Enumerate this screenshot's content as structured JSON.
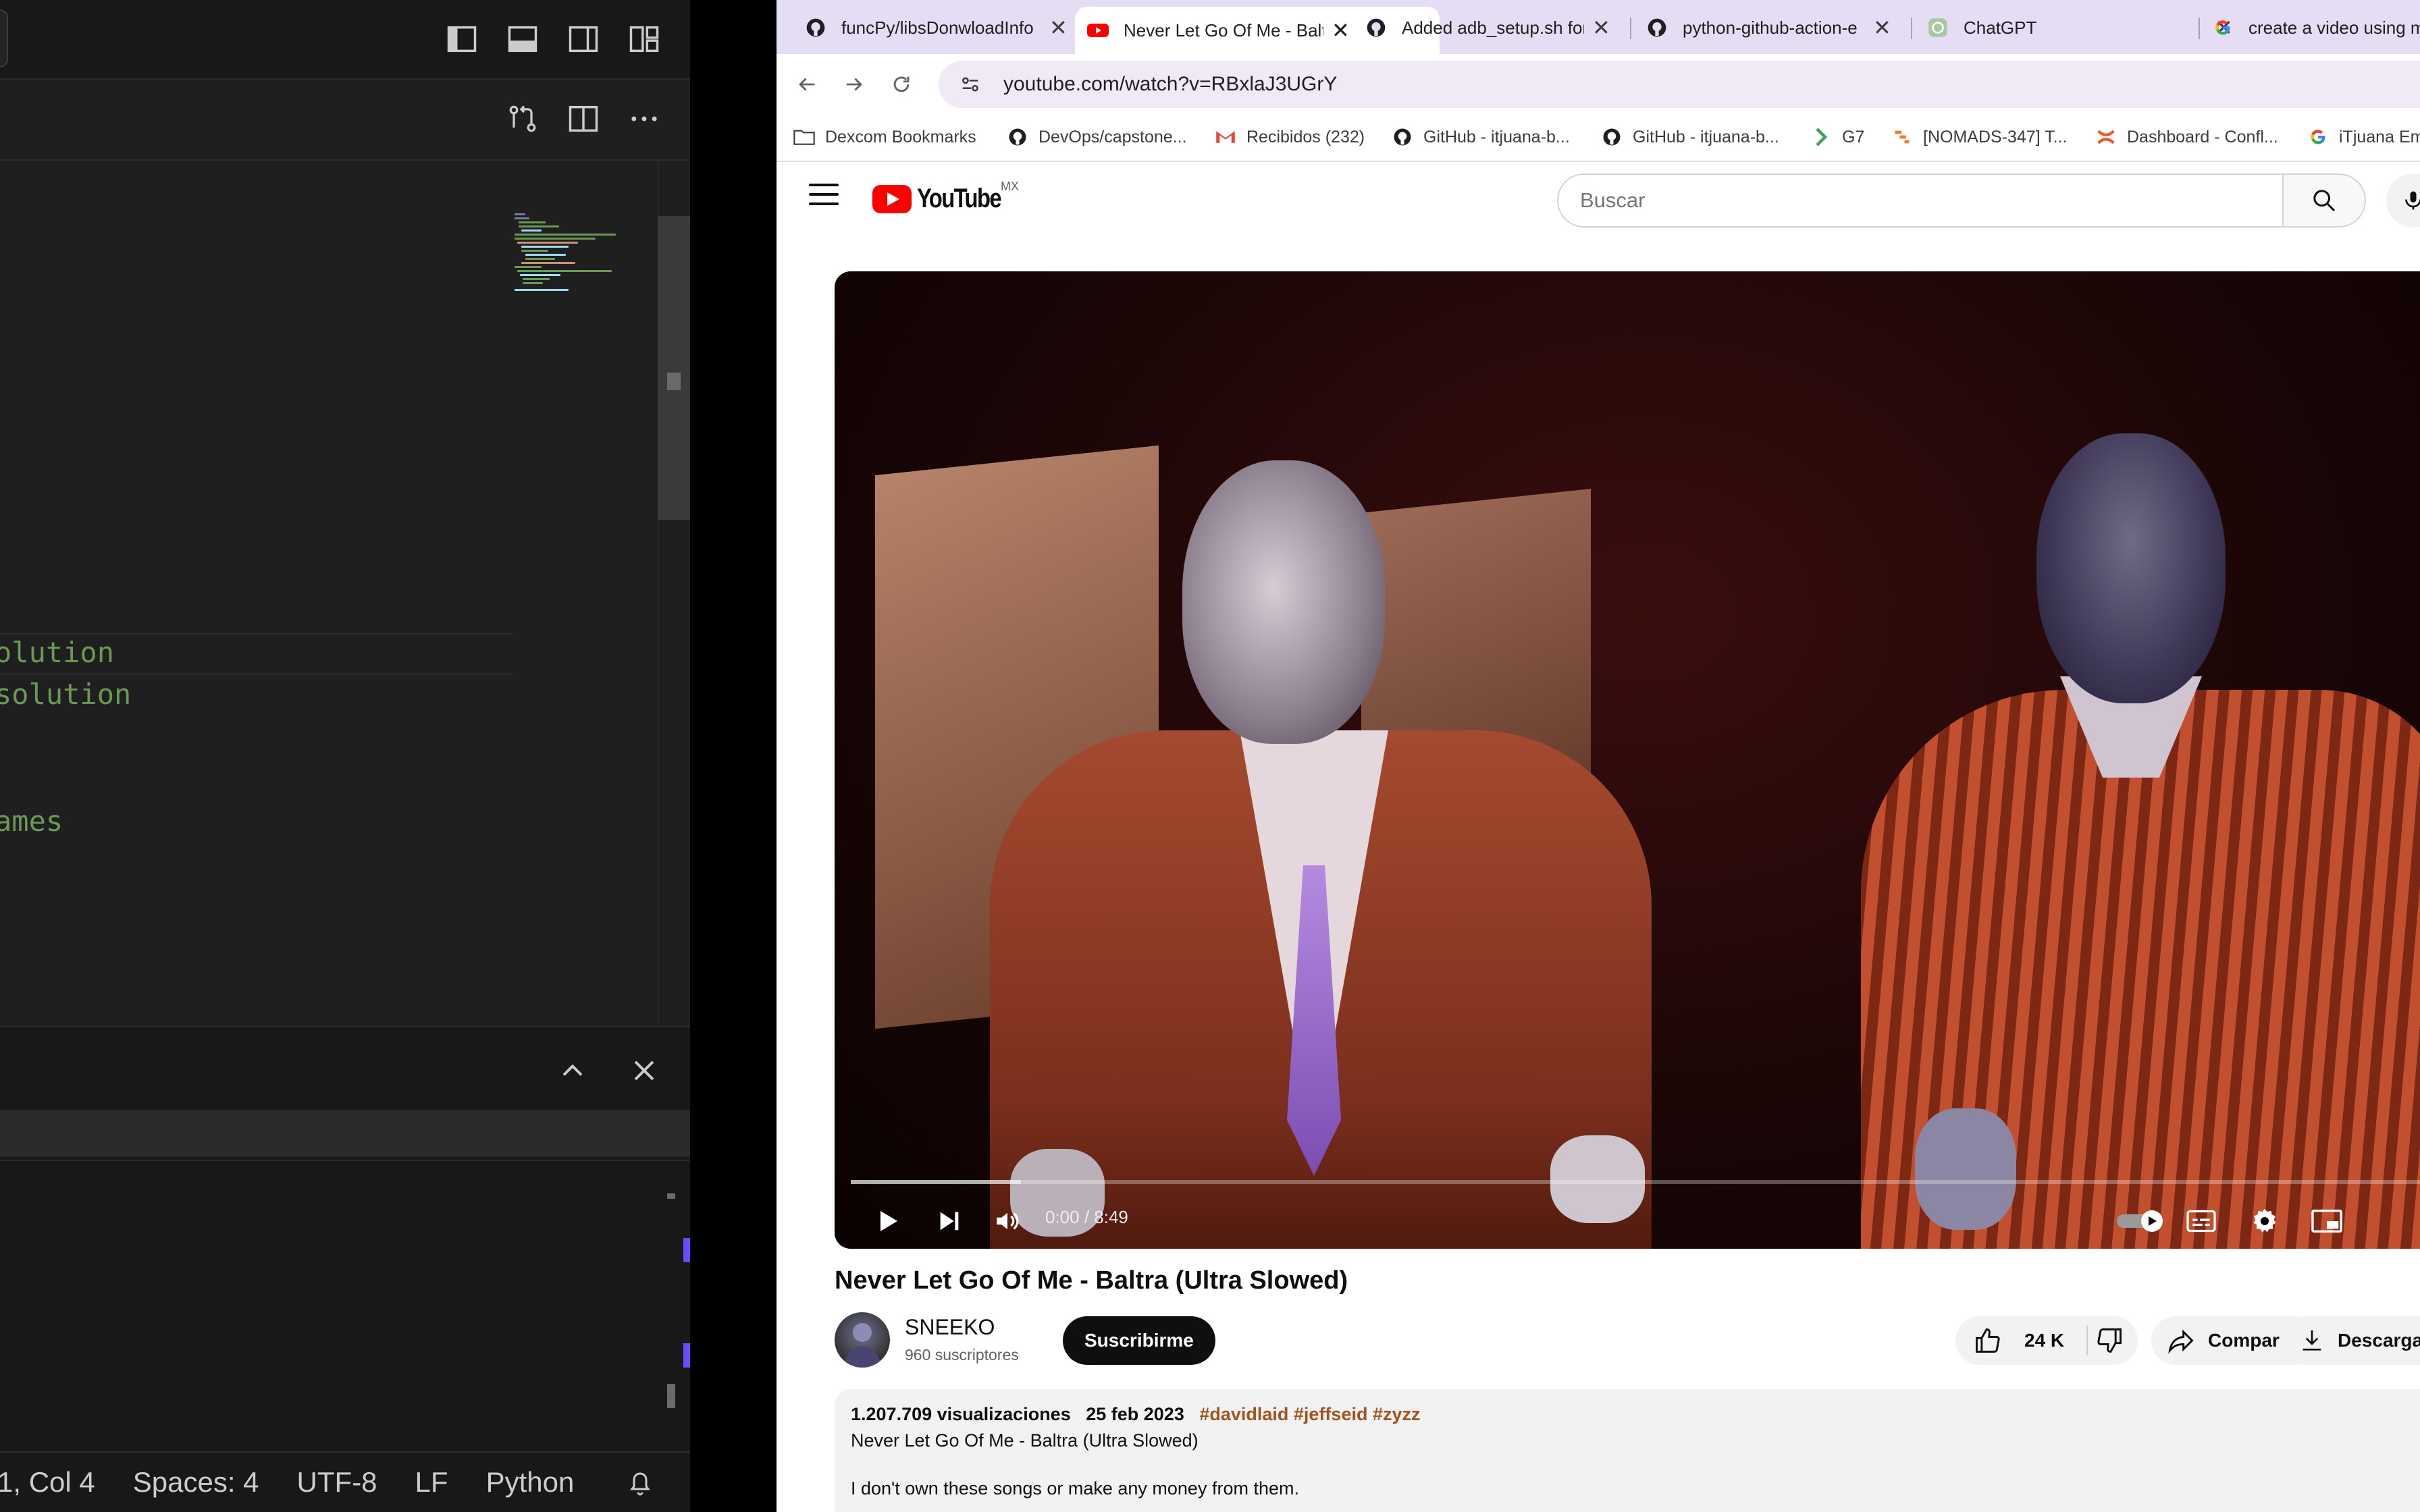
{
  "vscode": {
    "code_lines": [
      "olution",
      "solution",
      "ames"
    ],
    "status": {
      "position": "1, Col 4",
      "spaces": "Spaces: 4",
      "encoding": "UTF-8",
      "eol": "LF",
      "language": "Python"
    }
  },
  "browser": {
    "tabs": [
      {
        "title": "funcPy/libsDonwloadInfo",
        "icon": "github-icon"
      },
      {
        "title": "Never Let Go Of Me - Baltra",
        "icon": "youtube-icon",
        "active": true
      },
      {
        "title": "Added adb_setup.sh for",
        "icon": "github-icon"
      },
      {
        "title": "python-github-action-e",
        "icon": "github-icon"
      },
      {
        "title": "ChatGPT",
        "icon": "chatgpt-icon"
      },
      {
        "title": "create a video using ms",
        "icon": "google-icon"
      }
    ],
    "url": "youtube.com/watch?v=RBxlaJ3UGrY",
    "bookmarks": [
      {
        "label": "Dexcom Bookmarks",
        "icon": "folder-icon"
      },
      {
        "label": "DevOps/capstone...",
        "icon": "github-icon"
      },
      {
        "label": "Recibidos (232)",
        "icon": "gmail-icon"
      },
      {
        "label": "GitHub - itjuana-b...",
        "icon": "github-icon"
      },
      {
        "label": "GitHub - itjuana-b...",
        "icon": "github-icon"
      },
      {
        "label": "G7",
        "icon": "g7-icon"
      },
      {
        "label": "[NOMADS-347] T...",
        "icon": "jira-icon"
      },
      {
        "label": "Dashboard - Confl...",
        "icon": "confluence-icon"
      },
      {
        "label": "iTjuana Em",
        "icon": "google-icon"
      }
    ]
  },
  "youtube": {
    "logo_text": "YouTube",
    "country": "MX",
    "search_placeholder": "Buscar",
    "player": {
      "time": "0:00 / 8:49",
      "buffered_fraction": 0.106
    },
    "video_title": "Never Let Go Of Me - Baltra (Ultra Slowed)",
    "channel": {
      "name": "SNEEKO",
      "subscribers": "960 suscriptores",
      "subscribe_label": "Suscribirme"
    },
    "actions": {
      "likes": "24 K",
      "share": "Compartir",
      "download": "Descargar"
    },
    "description": {
      "views": "1.207.709 visualizaciones",
      "date": "25 feb 2023",
      "tags": "#davidlaid #jeffseid #zyzz",
      "line1": "Never Let Go Of Me - Baltra (Ultra Slowed)",
      "line2": "I don't own these songs or make any money from them."
    }
  },
  "colors": {
    "vscode_bg": "#1f1f1f",
    "code_comment": "#6a9955",
    "tab_strip": "#e5ddf3",
    "youtube_red": "#ff0000",
    "tag_color": "#a3531f"
  }
}
